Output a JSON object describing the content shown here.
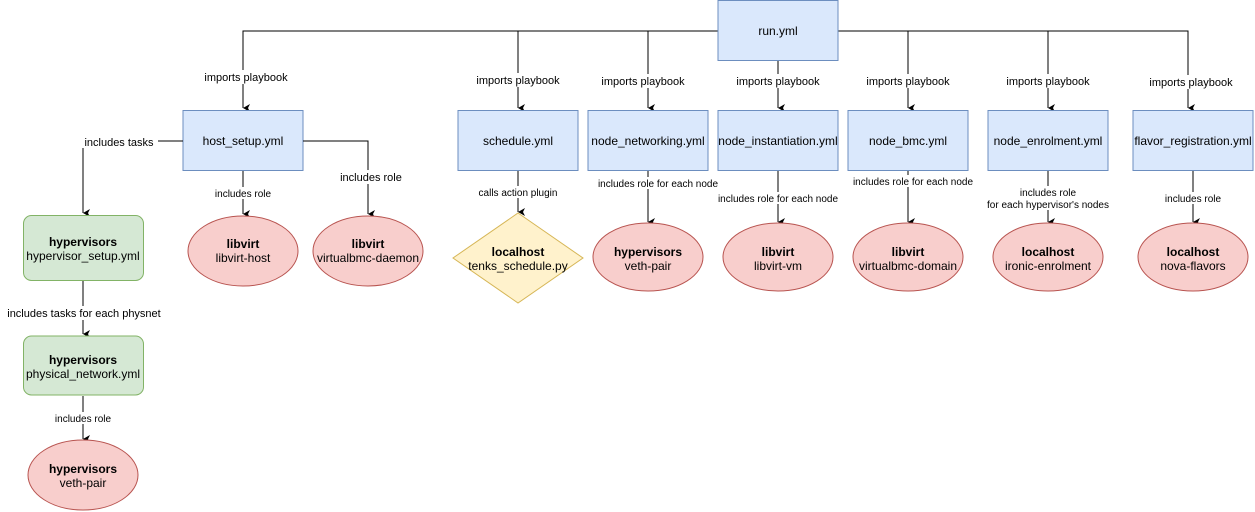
{
  "diagram": {
    "root": {
      "label": "run.yml"
    },
    "playbooks": [
      {
        "id": "host_setup",
        "label": "host_setup.yml",
        "edge_label": "imports playbook"
      },
      {
        "id": "schedule",
        "label": "schedule.yml",
        "edge_label": "imports playbook"
      },
      {
        "id": "node_networking",
        "label": "node_networking.yml",
        "edge_label": "imports playbook"
      },
      {
        "id": "node_instantiation",
        "label": "node_instantiation.yml",
        "edge_label": "imports playbook"
      },
      {
        "id": "node_bmc",
        "label": "node_bmc.yml",
        "edge_label": "imports playbook"
      },
      {
        "id": "node_enrolment",
        "label": "node_enrolment.yml",
        "edge_label": "imports playbook"
      },
      {
        "id": "flavor_registration",
        "label": "flavor_registration.yml",
        "edge_label": "imports playbook"
      }
    ],
    "tasks": [
      {
        "id": "hypervisor_setup",
        "host": "hypervisors",
        "label": "hypervisor_setup.yml",
        "edge_label": "includes tasks"
      },
      {
        "id": "physical_network",
        "host": "hypervisors",
        "label": "physical_network.yml",
        "edge_label": "includes tasks for each physnet"
      }
    ],
    "plugin": {
      "host": "localhost",
      "label": "tenks_schedule.py",
      "edge_label": "calls action plugin"
    },
    "roles": [
      {
        "id": "libvirt_host",
        "host": "libvirt",
        "label": "libvirt-host",
        "edge_label": "includes role"
      },
      {
        "id": "virtualbmc_daemon",
        "host": "libvirt",
        "label": "virtualbmc-daemon",
        "edge_label": "includes role"
      },
      {
        "id": "veth_pair_tasks",
        "host": "hypervisors",
        "label": "veth-pair",
        "edge_label": "includes role"
      },
      {
        "id": "veth_pair_net",
        "host": "hypervisors",
        "label": "veth-pair",
        "edge_label": "includes role for each node"
      },
      {
        "id": "libvirt_vm",
        "host": "libvirt",
        "label": "libvirt-vm",
        "edge_label": "includes role for each node"
      },
      {
        "id": "virtualbmc_domain",
        "host": "libvirt",
        "label": "virtualbmc-domain",
        "edge_label": "includes role for each node"
      },
      {
        "id": "ironic_enrolment",
        "host": "localhost",
        "label": "ironic-enrolment",
        "edge_label_1": "includes role",
        "edge_label_2": "for each hypervisor's nodes"
      },
      {
        "id": "nova_flavors",
        "host": "localhost",
        "label": "nova-flavors",
        "edge_label": "includes role"
      }
    ],
    "colors": {
      "playbook_fill": "#dae8fc",
      "playbook_stroke": "#6c8ebf",
      "task_fill": "#d5e8d4",
      "task_stroke": "#82b366",
      "role_fill": "#f8cecc",
      "role_stroke": "#b85450",
      "plugin_fill": "#fff2cc",
      "plugin_stroke": "#d6b656"
    }
  }
}
